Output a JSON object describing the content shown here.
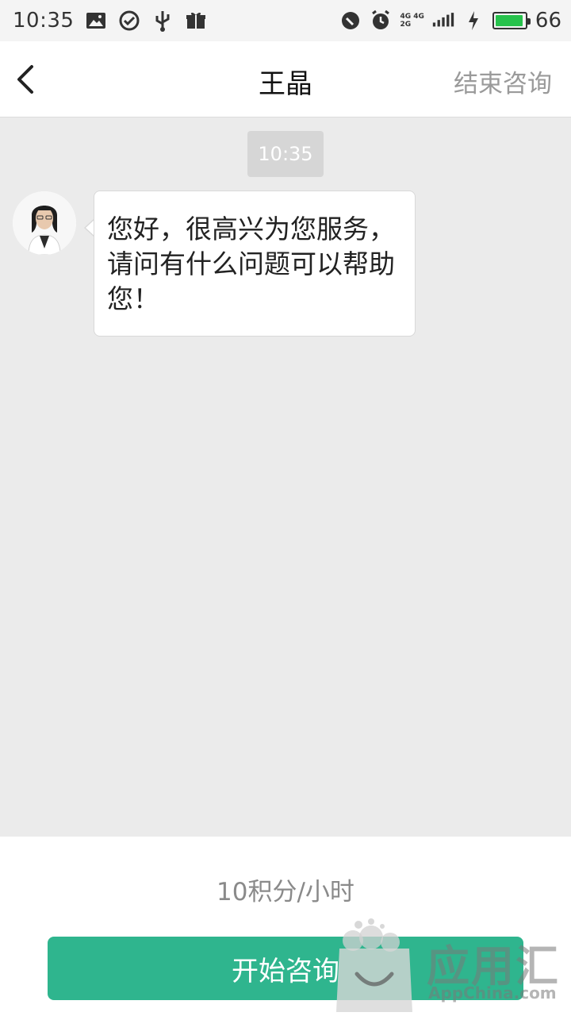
{
  "status_bar": {
    "time": "10:35",
    "network_top": "4G 4G",
    "network_bottom": "2G",
    "battery_level": 0.95,
    "battery_text": "66"
  },
  "header": {
    "title": "王晶",
    "end_consult_label": "结束咨询"
  },
  "chat": {
    "timestamp": "10:35",
    "messages": [
      {
        "text": "您好，很高兴为您服务，请问有什么问题可以帮助您！"
      }
    ]
  },
  "footer": {
    "price_text": "10积分/小时",
    "start_button_label": "开始咨询"
  },
  "watermark": {
    "brand": "应用汇",
    "brand_sub": "AppChina.com"
  },
  "colors": {
    "accent_green": "#2fb58e",
    "battery_green": "#27c24c",
    "chat_background": "#ebebeb"
  }
}
